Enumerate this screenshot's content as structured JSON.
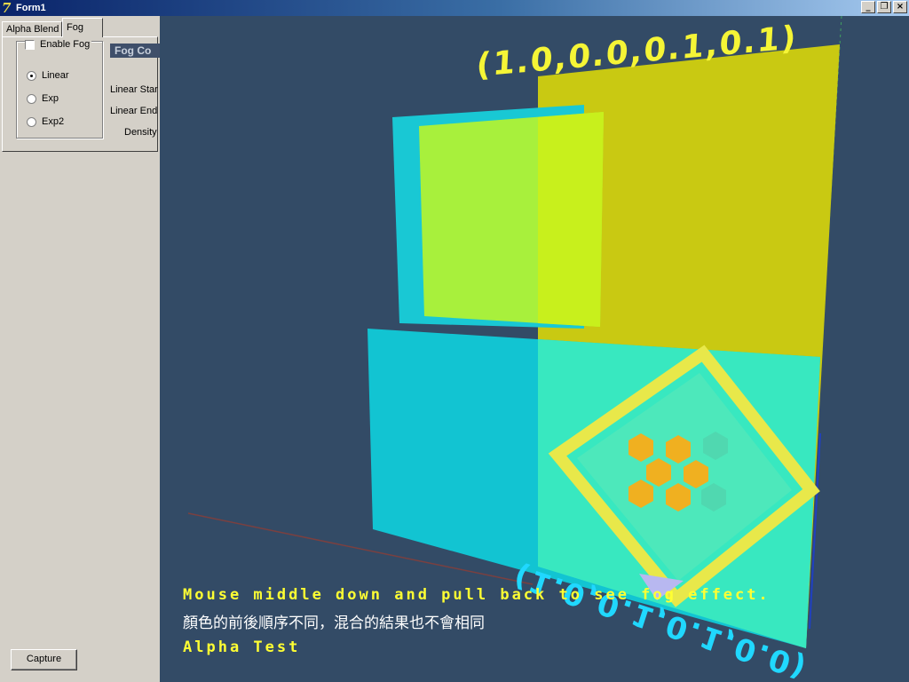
{
  "window": {
    "title": "Form1",
    "buttons": {
      "minimize": "_",
      "restore": "❐",
      "close": "×"
    }
  },
  "tabs": [
    {
      "label": "Alpha Blend"
    },
    {
      "label": "Fog"
    }
  ],
  "fog": {
    "enable_label": "Enable Fog",
    "enabled": false,
    "modes": [
      {
        "label": "Linear",
        "selected": true
      },
      {
        "label": "Exp",
        "selected": false
      },
      {
        "label": "Exp2",
        "selected": false
      }
    ],
    "header": "Fog Co",
    "linear_start_label": "Linear Star",
    "linear_end_label": "Linear End",
    "density_label": "Density"
  },
  "capture_label": "Capture",
  "viewport": {
    "background": "#334b66",
    "hint_text": "Mouse middle down and pull back to see fog effect.",
    "chinese_text": "顏色的前後順序不同，混合的結果也不會相同",
    "mode_text": "Alpha Test",
    "top_3d_text": "(1.0,0.0,0.1,0.1)",
    "bottom_3d_text": "(1.0,0.1,0.1,0.0)"
  },
  "colors": {
    "overlay_yellow": "#ffff33",
    "title_gradient_start": "#0a246a",
    "cyan_plane": "#15c8d8",
    "yellow_plane": "#cccc10"
  }
}
